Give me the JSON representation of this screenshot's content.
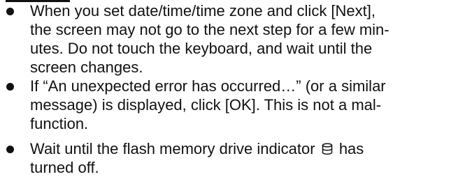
{
  "notes": [
    {
      "lines": [
        "When you set date/time/time zone and click [Next],",
        "the screen may not go to the next step for a few min-",
        "utes. Do not touch the keyboard, and wait until the",
        "screen changes."
      ]
    },
    {
      "lines": [
        "If “An unexpected error has occurred…” (or a similar",
        "message) is displayed, click [OK]. This is not a mal-",
        "function."
      ]
    },
    {
      "line1_before": "Wait until the flash memory drive indicator",
      "line1_after": "has",
      "line2": "turned off.",
      "icon": "flash-memory-drive-indicator-icon"
    }
  ]
}
